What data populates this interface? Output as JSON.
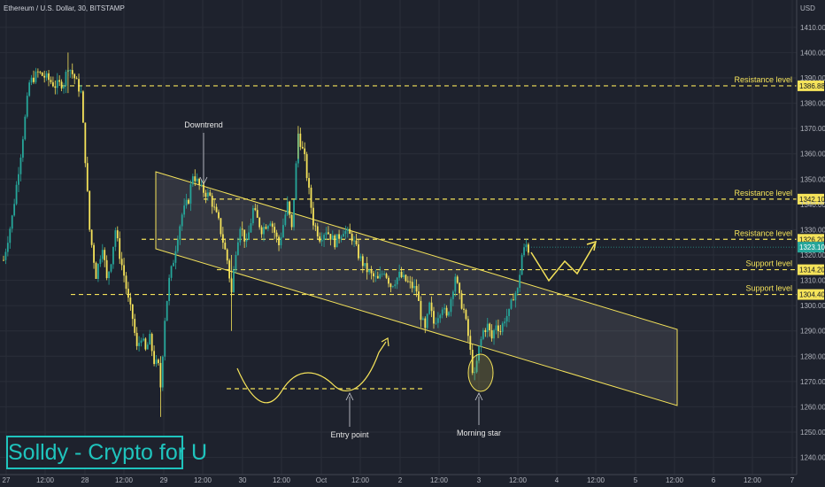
{
  "symbol": "Ethereum / U.S. Dollar, 30, BITSTAMP",
  "brand": "Solldy - Crypto for U",
  "colors": {
    "background": "#1e222d",
    "grid": "#2a2e39",
    "up": "#26a69a",
    "down": "#f5e35a",
    "annotation": "#f5e35a",
    "brand": "#1fc4bd"
  },
  "chart_data": {
    "type": "candlestick",
    "y_unit": "USD",
    "ylim": [
      1236,
      1418
    ],
    "y_ticks": [
      1240,
      1250,
      1260,
      1270,
      1280,
      1290,
      1300,
      1310,
      1320,
      1330,
      1340,
      1350,
      1360,
      1370,
      1380,
      1390,
      1400,
      1410
    ],
    "x_tick_labels": [
      "27",
      "12:00",
      "28",
      "12:00",
      "29",
      "12:00",
      "30",
      "12:00",
      "Oct",
      "12:00",
      "2",
      "12:00",
      "3",
      "12:00",
      "4",
      "12:00",
      "5",
      "12:00",
      "6",
      "12:00",
      "7"
    ],
    "grid": true,
    "price_path": [
      [
        0,
        1318
      ],
      [
        4,
        1335
      ],
      [
        8,
        1360
      ],
      [
        12,
        1388
      ],
      [
        16,
        1392
      ],
      [
        20,
        1390
      ],
      [
        24,
        1387
      ],
      [
        28,
        1388
      ],
      [
        30,
        1395
      ],
      [
        33,
        1390
      ],
      [
        36,
        1384
      ],
      [
        38,
        1358
      ],
      [
        40,
        1330
      ],
      [
        43,
        1312
      ],
      [
        46,
        1324
      ],
      [
        48,
        1310
      ],
      [
        50,
        1318
      ],
      [
        52,
        1330
      ],
      [
        54,
        1320
      ],
      [
        56,
        1312
      ],
      [
        58,
        1302
      ],
      [
        60,
        1295
      ],
      [
        62,
        1283
      ],
      [
        64,
        1288
      ],
      [
        66,
        1282
      ],
      [
        68,
        1287
      ],
      [
        70,
        1278
      ],
      [
        72,
        1276
      ],
      [
        73,
        1268
      ],
      [
        75,
        1295
      ],
      [
        77,
        1310
      ],
      [
        79,
        1318
      ],
      [
        81,
        1328
      ],
      [
        83,
        1336
      ],
      [
        86,
        1342
      ],
      [
        88,
        1352
      ],
      [
        92,
        1346
      ],
      [
        96,
        1343
      ],
      [
        100,
        1333
      ],
      [
        104,
        1318
      ],
      [
        106,
        1305
      ],
      [
        108,
        1322
      ],
      [
        110,
        1332
      ],
      [
        113,
        1324
      ],
      [
        116,
        1338
      ],
      [
        120,
        1330
      ],
      [
        124,
        1334
      ],
      [
        128,
        1324
      ],
      [
        132,
        1340
      ],
      [
        134,
        1330
      ],
      [
        137,
        1368
      ],
      [
        140,
        1358
      ],
      [
        142,
        1345
      ],
      [
        144,
        1333
      ],
      [
        147,
        1327
      ],
      [
        150,
        1330
      ],
      [
        154,
        1325
      ],
      [
        158,
        1330
      ],
      [
        162,
        1327
      ],
      [
        165,
        1320
      ],
      [
        168,
        1315
      ],
      [
        171,
        1312
      ],
      [
        174,
        1310
      ],
      [
        177,
        1314
      ],
      [
        180,
        1308
      ],
      [
        184,
        1312
      ],
      [
        188,
        1309
      ],
      [
        192,
        1306
      ],
      [
        194,
        1296
      ],
      [
        196,
        1290
      ],
      [
        198,
        1300
      ],
      [
        200,
        1293
      ],
      [
        204,
        1300
      ],
      [
        206,
        1295
      ],
      [
        208,
        1303
      ],
      [
        210,
        1312
      ],
      [
        212,
        1303
      ],
      [
        214,
        1298
      ],
      [
        216,
        1288
      ],
      [
        218,
        1275
      ],
      [
        219,
        1272
      ],
      [
        221,
        1283
      ],
      [
        223,
        1290
      ],
      [
        225,
        1292
      ],
      [
        227,
        1287
      ],
      [
        229,
        1293
      ],
      [
        231,
        1290
      ],
      [
        233,
        1295
      ],
      [
        235,
        1297
      ],
      [
        237,
        1304
      ],
      [
        239,
        1306
      ],
      [
        241,
        1320
      ],
      [
        243,
        1324
      ],
      [
        244,
        1322
      ]
    ],
    "levels": [
      {
        "label": "Resistance level",
        "price": 1386.88,
        "tag": "1386.88"
      },
      {
        "label": "Resistance level",
        "price": 1342.1,
        "tag": "1342.10"
      },
      {
        "label": "Resistance level",
        "price": 1326.2,
        "tag": "1326.20"
      },
      {
        "label": "Support level",
        "price": 1314.2,
        "tag": "1314.20"
      },
      {
        "label": "Support level",
        "price": 1304.4,
        "tag": "1304.40"
      }
    ],
    "current_price": {
      "value": 1323.1,
      "tag": "1323.10"
    },
    "annotations": [
      "Downtrend",
      "Entry point",
      "Morning star"
    ]
  }
}
